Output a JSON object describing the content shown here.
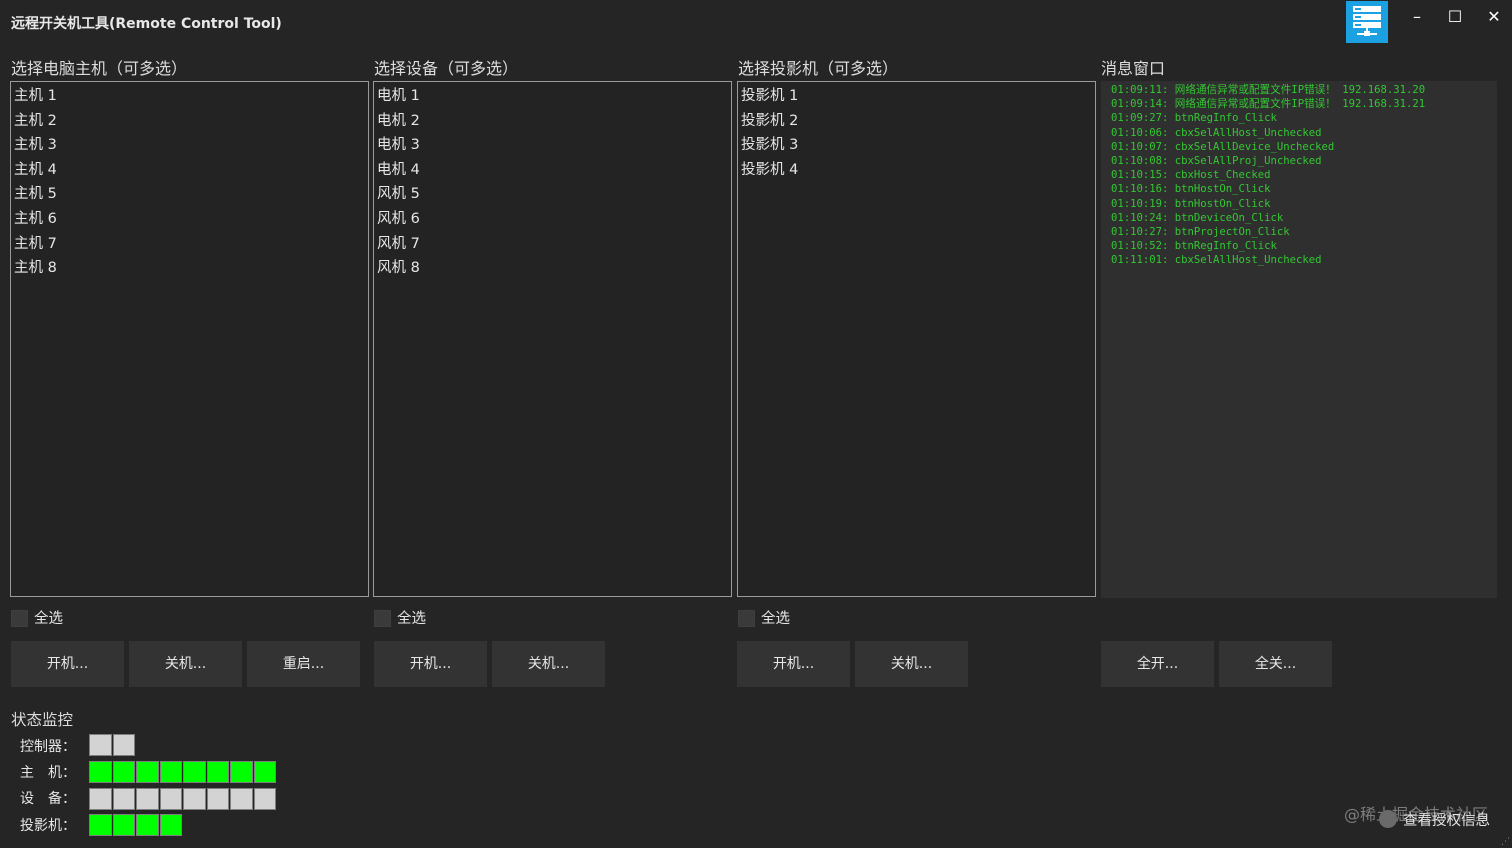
{
  "window": {
    "title": "远程开关机工具(Remote Control Tool)",
    "minimize": "–",
    "maximize": "☐",
    "close": "✕",
    "accent": "#1ba1e2"
  },
  "hosts": {
    "label": "选择电脑主机（可多选）",
    "items": [
      "主机 1",
      "主机 2",
      "主机 3",
      "主机 4",
      "主机 5",
      "主机 6",
      "主机 7",
      "主机 8"
    ],
    "select_all": "全选",
    "buttons": [
      "开机...",
      "关机...",
      "重启..."
    ]
  },
  "devices": {
    "label": "选择设备（可多选）",
    "items": [
      "电机 1",
      "电机 2",
      "电机 3",
      "电机 4",
      "风机 5",
      "风机 6",
      "风机 7",
      "风机 8"
    ],
    "select_all": "全选",
    "buttons": [
      "开机...",
      "关机..."
    ]
  },
  "projectors": {
    "label": "选择投影机（可多选）",
    "items": [
      "投影机 1",
      "投影机 2",
      "投影机 3",
      "投影机 4"
    ],
    "select_all": "全选",
    "buttons": [
      "开机...",
      "关机..."
    ]
  },
  "messages": {
    "label": "消息窗口",
    "log": [
      "01:09:11: 网络通信异常或配置文件IP错误！ 192.168.31.20",
      "01:09:14: 网络通信异常或配置文件IP错误！ 192.168.31.21",
      "01:09:27: btnRegInfo_Click",
      "01:10:06: cbxSelAllHost_Unchecked",
      "01:10:07: cbxSelAllDevice_Unchecked",
      "01:10:08: cbxSelAllProj_Unchecked",
      "01:10:15: cbxHost_Checked",
      "01:10:16: btnHostOn_Click",
      "01:10:19: btnHostOn_Click",
      "01:10:24: btnDeviceOn_Click",
      "01:10:27: btnProjectOn_Click",
      "01:10:52: btnRegInfo_Click",
      "01:11:01: cbxSelAllHost_Unchecked"
    ],
    "color": "#32c832",
    "buttons": [
      "全开...",
      "全关..."
    ]
  },
  "status": {
    "title": "状态监控",
    "on_color": "#00ff00",
    "off_color": "#d3d3d3",
    "rows": [
      {
        "label": "控制器：",
        "states": [
          false,
          false
        ]
      },
      {
        "label": "主　机：",
        "states": [
          true,
          true,
          true,
          true,
          true,
          true,
          true,
          true
        ]
      },
      {
        "label": "设　备：",
        "states": [
          false,
          false,
          false,
          false,
          false,
          false,
          false,
          false
        ]
      },
      {
        "label": "投影机：",
        "states": [
          true,
          true,
          true,
          true
        ]
      }
    ]
  },
  "footer": {
    "watermark": "@稀土掘金技术社区",
    "license_link": "查看授权信息"
  }
}
